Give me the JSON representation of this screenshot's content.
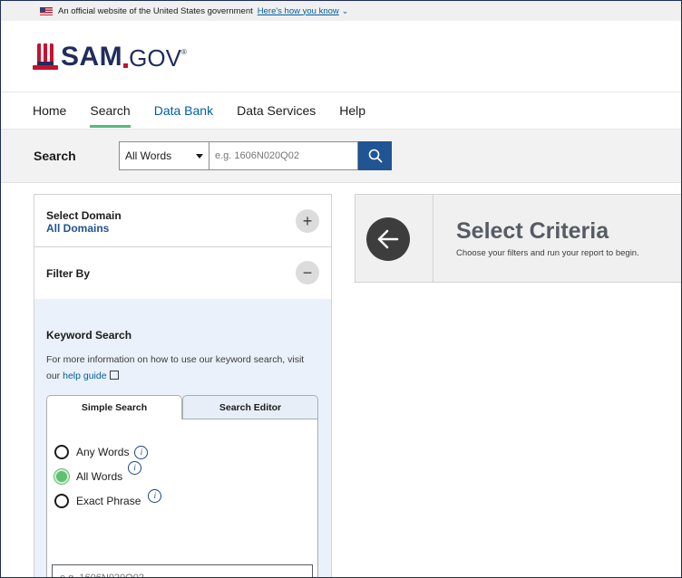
{
  "banner": {
    "text": "An official website of the United States government",
    "link": "Here's how you know"
  },
  "logo": {
    "text": "SAM",
    "suffix": "GOV",
    "reg": "®"
  },
  "nav": [
    {
      "label": "Home"
    },
    {
      "label": "Search"
    },
    {
      "label": "Data Bank"
    },
    {
      "label": "Data Services"
    },
    {
      "label": "Help"
    }
  ],
  "search": {
    "label": "Search",
    "scope": "All Words",
    "placeholder": "e.g. 1606N020Q02"
  },
  "domain": {
    "title": "Select Domain",
    "value": "All Domains"
  },
  "filter": {
    "title": "Filter By"
  },
  "keyword": {
    "title": "Keyword Search",
    "desc": "For more information on how to use our keyword search, visit our",
    "link": "help guide",
    "tabs": [
      "Simple Search",
      "Search Editor"
    ],
    "options": [
      "Any Words",
      "All Words",
      "Exact Phrase"
    ],
    "selected": "All Words",
    "placeholder": "e.g. 1606N020Q02"
  },
  "criteria": {
    "title": "Select Criteria",
    "subtitle": "Choose your filters and run your report to begin."
  },
  "colors": {
    "accent": "#56b978",
    "primary": "#205493",
    "brand_navy": "#1f2d5c",
    "brand_red": "#c41230"
  }
}
